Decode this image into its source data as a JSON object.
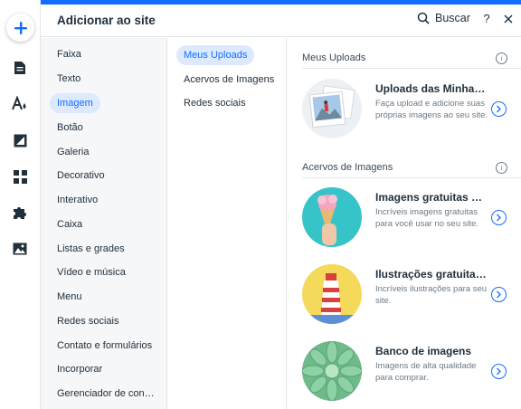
{
  "header": {
    "title": "Adicionar ao site",
    "search_label": "Buscar",
    "help_label": "?"
  },
  "rail": {
    "items": [
      "add-icon",
      "page-icon",
      "design-icon",
      "background-icon",
      "apps-icon",
      "puzzle-icon",
      "media-icon"
    ]
  },
  "categories": [
    {
      "label": "Faixa"
    },
    {
      "label": "Texto"
    },
    {
      "label": "Imagem",
      "active": true
    },
    {
      "label": "Botão"
    },
    {
      "label": "Galeria"
    },
    {
      "label": "Decorativo"
    },
    {
      "label": "Interativo"
    },
    {
      "label": "Caixa"
    },
    {
      "label": "Listas e grades"
    },
    {
      "label": "Vídeo e música"
    },
    {
      "label": "Menu"
    },
    {
      "label": "Redes sociais"
    },
    {
      "label": "Contato e formulários"
    },
    {
      "label": "Incorporar"
    },
    {
      "label": "Gerenciador de con…"
    }
  ],
  "subcategories": [
    {
      "label": "Meus Uploads",
      "active": true
    },
    {
      "label": "Acervos de Imagens"
    },
    {
      "label": "Redes sociais"
    }
  ],
  "sections": [
    {
      "title": "Meus Uploads",
      "cards": [
        {
          "title": "Uploads das Minha…",
          "desc": "Faça upload e adicione suas próprias imagens ao seu site."
        }
      ]
    },
    {
      "title": "Acervos de Imagens",
      "cards": [
        {
          "title": "Imagens gratuitas …",
          "desc": "Incríveis imagens gratuitas para você usar no seu site."
        },
        {
          "title": "Ilustrações gratuita…",
          "desc": "Incríveis ilustrações para seu site."
        },
        {
          "title": "Banco de imagens",
          "desc": "Imagens de alta qualidade para comprar."
        }
      ]
    }
  ],
  "colors": {
    "accent": "#116dff",
    "active_bg": "#dce9ff",
    "panel_bg": "#f5f7f9"
  }
}
